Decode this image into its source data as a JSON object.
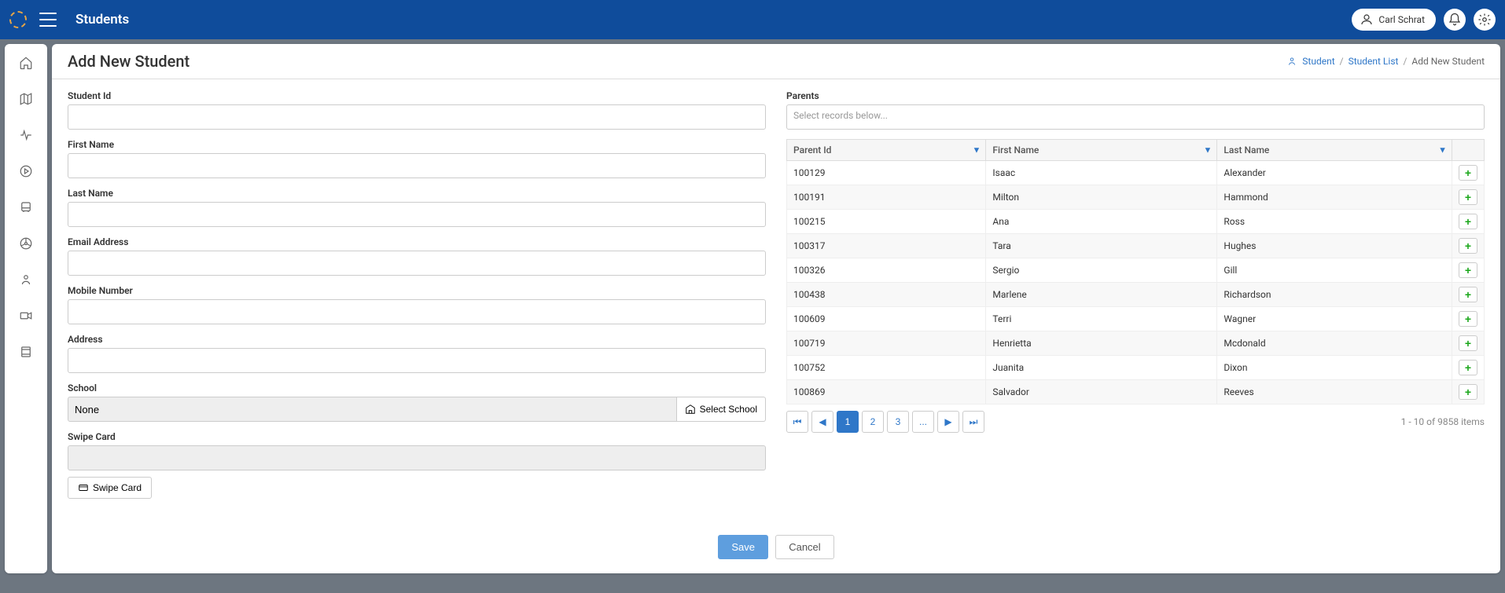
{
  "topbar": {
    "title": "Students",
    "user_name": "Carl Schrat"
  },
  "page": {
    "title": "Add New Student"
  },
  "breadcrumb": {
    "student": "Student",
    "student_list": "Student List",
    "current": "Add New Student"
  },
  "form": {
    "labels": {
      "student_id": "Student Id",
      "first_name": "First Name",
      "last_name": "Last Name",
      "email": "Email Address",
      "mobile": "Mobile Number",
      "address": "Address",
      "school": "School",
      "swipe_card": "Swipe Card",
      "parents": "Parents"
    },
    "school_value": "None",
    "select_school_btn": "Select School",
    "swipe_card_btn": "Swipe Card",
    "parents_placeholder": "Select records below..."
  },
  "parents_table": {
    "headers": {
      "parent_id": "Parent Id",
      "first_name": "First Name",
      "last_name": "Last Name"
    },
    "rows": [
      {
        "id": "100129",
        "first": "Isaac",
        "last": "Alexander"
      },
      {
        "id": "100191",
        "first": "Milton",
        "last": "Hammond"
      },
      {
        "id": "100215",
        "first": "Ana",
        "last": "Ross"
      },
      {
        "id": "100317",
        "first": "Tara",
        "last": "Hughes"
      },
      {
        "id": "100326",
        "first": "Sergio",
        "last": "Gill"
      },
      {
        "id": "100438",
        "first": "Marlene",
        "last": "Richardson"
      },
      {
        "id": "100609",
        "first": "Terri",
        "last": "Wagner"
      },
      {
        "id": "100719",
        "first": "Henrietta",
        "last": "Mcdonald"
      },
      {
        "id": "100752",
        "first": "Juanita",
        "last": "Dixon"
      },
      {
        "id": "100869",
        "first": "Salvador",
        "last": "Reeves"
      }
    ],
    "pages": [
      "1",
      "2",
      "3",
      "..."
    ],
    "info": "1 - 10 of 9858 items"
  },
  "actions": {
    "save": "Save",
    "cancel": "Cancel"
  }
}
